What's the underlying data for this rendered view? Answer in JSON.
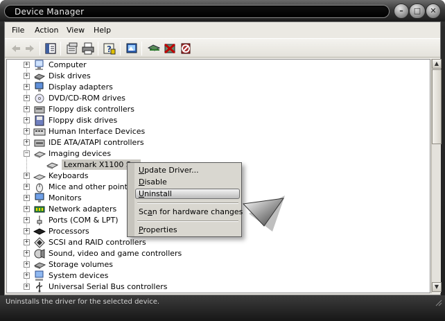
{
  "window": {
    "title": "Device Manager"
  },
  "menubar": {
    "items": [
      "File",
      "Action",
      "View",
      "Help"
    ]
  },
  "toolbar": {
    "buttons": [
      "back-icon",
      "forward-icon",
      "show-hide-tree-icon",
      "properties-icon",
      "print-icon",
      "help-icon",
      "scan-hardware-icon",
      "update-driver-icon",
      "disable-icon",
      "uninstall-icon"
    ]
  },
  "tree": {
    "categories": [
      {
        "label": "Computer",
        "icon": "computer-icon",
        "expanded": false
      },
      {
        "label": "Disk drives",
        "icon": "disk-drive-icon",
        "expanded": false
      },
      {
        "label": "Display adapters",
        "icon": "display-adapter-icon",
        "expanded": false
      },
      {
        "label": "DVD/CD-ROM drives",
        "icon": "cdrom-icon",
        "expanded": false
      },
      {
        "label": "Floppy disk controllers",
        "icon": "floppy-controller-icon",
        "expanded": false
      },
      {
        "label": "Floppy disk drives",
        "icon": "floppy-drive-icon",
        "expanded": false
      },
      {
        "label": "Human Interface Devices",
        "icon": "hid-icon",
        "expanded": false
      },
      {
        "label": "IDE ATA/ATAPI controllers",
        "icon": "ide-controller-icon",
        "expanded": false
      },
      {
        "label": "Imaging devices",
        "icon": "scanner-icon",
        "expanded": true
      },
      {
        "label": "Lexmark X1100 Ser",
        "icon": "scanner-icon",
        "child": true
      },
      {
        "label": "Keyboards",
        "icon": "keyboard-icon",
        "expanded": false
      },
      {
        "label": "Mice and other pointing",
        "icon": "mouse-icon",
        "expanded": false
      },
      {
        "label": "Monitors",
        "icon": "monitor-icon",
        "expanded": false
      },
      {
        "label": "Network adapters",
        "icon": "network-adapter-icon",
        "expanded": false
      },
      {
        "label": "Ports (COM & LPT)",
        "icon": "port-icon",
        "expanded": false
      },
      {
        "label": "Processors",
        "icon": "processor-icon",
        "expanded": false
      },
      {
        "label": "SCSI and RAID controllers",
        "icon": "scsi-icon",
        "expanded": false
      },
      {
        "label": "Sound, video and game controllers",
        "icon": "sound-icon",
        "expanded": false
      },
      {
        "label": "Storage volumes",
        "icon": "storage-icon",
        "expanded": false
      },
      {
        "label": "System devices",
        "icon": "system-icon",
        "expanded": false
      },
      {
        "label": "Universal Serial Bus controllers",
        "icon": "usb-icon",
        "expanded": false
      }
    ]
  },
  "context_menu": {
    "items": [
      {
        "label": "Update Driver...",
        "underline": "U",
        "rest": "pdate Driver..."
      },
      {
        "label": "Disable",
        "underline": "D",
        "rest": "isable"
      },
      {
        "label": "Uninstall",
        "underline": "U",
        "rest": "ninstall",
        "highlighted": true
      },
      {
        "label": "Scan for hardware changes",
        "pre": "Sc",
        "underline": "a",
        "rest": "n for hardware changes"
      },
      {
        "label": "Properties",
        "underline": "P",
        "rest": "roperties"
      }
    ]
  },
  "statusbar": {
    "text": "Uninstalls the driver for the selected device."
  },
  "colors": {
    "frame": "#1f1f1f",
    "client": "#ebe9e3",
    "tree_bg": "#ffffff",
    "menu_bg": "#d9d7d0",
    "status_text": "#d2d2d2"
  }
}
